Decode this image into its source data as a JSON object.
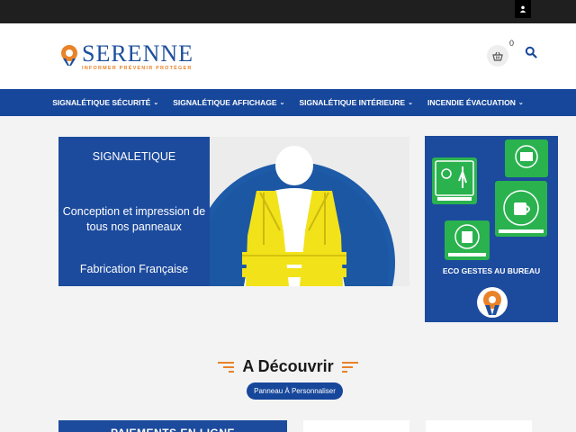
{
  "header": {
    "brand": "SERENNE",
    "tagline": "INFORMER PRÉVENIR PROTÉGER",
    "cart_count": "0"
  },
  "nav": {
    "items": [
      {
        "label": "SIGNALÉTIQUE SÉCURITÉ"
      },
      {
        "label": "SIGNALÉTIQUE AFFICHAGE"
      },
      {
        "label": "SIGNALÉTIQUE INTÉRIEURE"
      },
      {
        "label": "INCENDIE ÉVACUATION"
      }
    ]
  },
  "banner": {
    "title": "SIGNALETIQUE",
    "text": "Conception et impression de tous nos panneaux",
    "footer": "Fabrication Française"
  },
  "promo": {
    "caption": "ECO GESTES AU BUREAU"
  },
  "section": {
    "title": "A Découvrir",
    "pill": "Panneau À Personnaliser"
  },
  "cards": {
    "first_title": "PAIEMENTS EN LIGNE"
  },
  "colors": {
    "brand_blue": "#17479a",
    "accent_orange": "#e8832a",
    "safety_yellow": "#f2e21a"
  }
}
